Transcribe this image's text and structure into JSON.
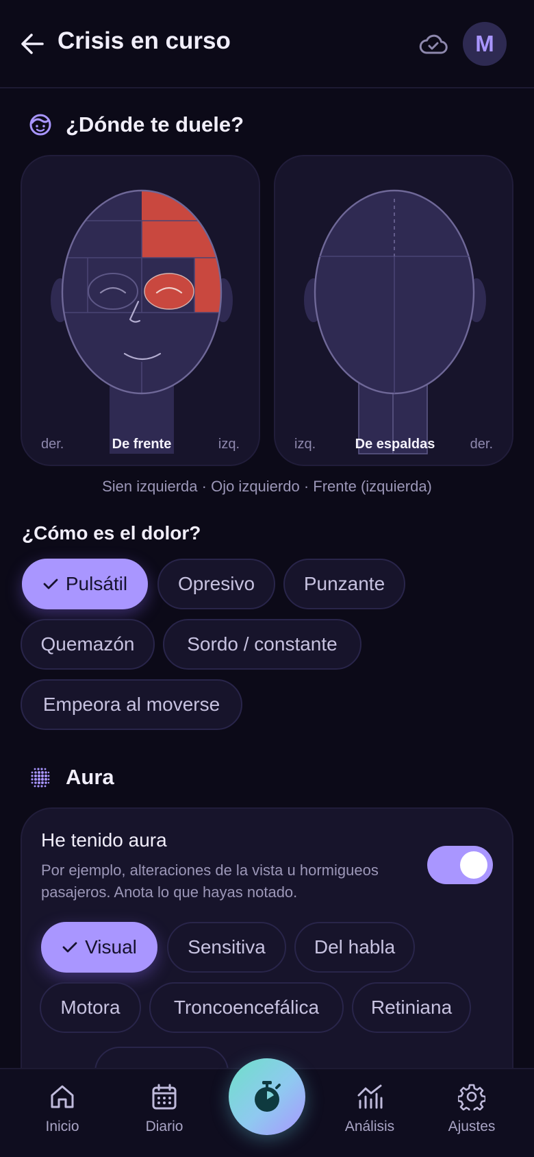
{
  "header": {
    "title": "Crisis en curso",
    "avatar_initial": "M"
  },
  "location": {
    "heading": "¿Dónde te duele?",
    "front": {
      "left_label": "der.",
      "center_label": "De frente",
      "right_label": "izq."
    },
    "back": {
      "left_label": "izq.",
      "center_label": "De espaldas",
      "right_label": "der."
    },
    "selected_summary": "Sien izquierda · Ojo izquierdo · Frente (izquierda)",
    "highlight_color": "#c9483f"
  },
  "pain_type": {
    "heading": "¿Cómo es el dolor?",
    "chips": [
      {
        "label": "Pulsátil",
        "selected": true
      },
      {
        "label": "Opresivo",
        "selected": false
      },
      {
        "label": "Punzante",
        "selected": false
      },
      {
        "label": "Quemazón",
        "selected": false
      },
      {
        "label": "Sordo / constante",
        "selected": false
      },
      {
        "label": "Empeora al moverse",
        "selected": false
      }
    ]
  },
  "aura": {
    "heading": "Aura",
    "toggle_title": "He tenido aura",
    "toggle_desc": "Por ejemplo, alteraciones de la vista u hormigueos pasajeros. Anota lo que hayas notado.",
    "toggle_on": true,
    "chips": [
      {
        "label": "Visual",
        "selected": true
      },
      {
        "label": "Sensitiva",
        "selected": false
      },
      {
        "label": "Del habla",
        "selected": false
      },
      {
        "label": "Motora",
        "selected": false
      },
      {
        "label": "Troncoencefálica",
        "selected": false
      },
      {
        "label": "Retiniana",
        "selected": false
      }
    ]
  },
  "nav": {
    "items": [
      {
        "label": "Inicio",
        "icon": "home-icon"
      },
      {
        "label": "Diario",
        "icon": "calendar-icon"
      },
      {
        "label": "Análisis",
        "icon": "chart-icon"
      },
      {
        "label": "Ajustes",
        "icon": "gear-icon"
      }
    ],
    "fab_icon": "stopwatch-icon"
  },
  "colors": {
    "accent": "#a996ff",
    "background": "#0c0a18",
    "card": "#17142b"
  }
}
